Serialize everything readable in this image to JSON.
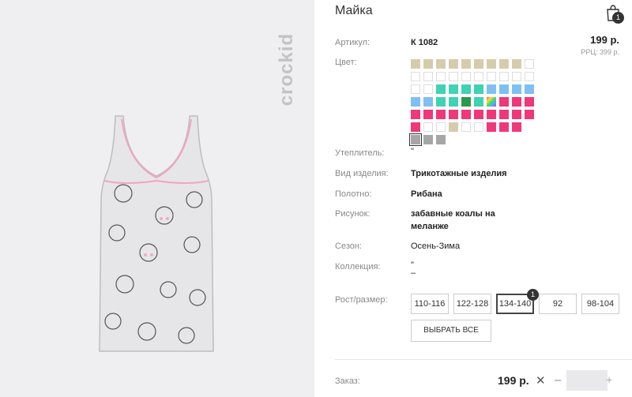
{
  "product": {
    "brand": "crockid",
    "title": "Майка",
    "cart_count": "1",
    "price": "199 р.",
    "rrp": "РРЦ: 399 р."
  },
  "details": {
    "article_label": "Артикул:",
    "article_value": "К 1082",
    "color_label": "Цвет:",
    "insulation_label": "Утеплитель:",
    "insulation_value": "\"",
    "type_label": "Вид изделия:",
    "type_value": "Трикотажные изделия",
    "fabric_label": "Полотно:",
    "fabric_value": "Рибана",
    "print_label": "Рисунок:",
    "print_value_1": "забавные коалы на",
    "print_value_2": "меланже",
    "season_label": "Сезон:",
    "season_value": "Осень-Зима",
    "collection_label": "Коллекция:",
    "collection_value_1": "\"",
    "collection_value_2": "–"
  },
  "sizes": {
    "label": "Рост/размер:",
    "options": [
      "110-116",
      "122-128",
      "134-140",
      "92",
      "98-104"
    ],
    "selected": "134-140",
    "selected_count": "1",
    "select_all": "ВЫБРАТЬ ВСЕ"
  },
  "order": {
    "label": "Заказ:",
    "price": "199 р.",
    "remove": "✕",
    "minus": "–",
    "plus": "+",
    "quantity": ""
  },
  "colors": {
    "beige": "#d6cbac",
    "white": "#ffffff",
    "turquoise": "#3fd2b5",
    "sky": "#7ec0f3",
    "green": "#2c9a4e",
    "pink": "#f0377a",
    "gray": "#a6a6a6"
  },
  "swatch_rows": [
    [
      "beige",
      "beige",
      "beige",
      "beige",
      "beige",
      "beige",
      "beige",
      "beige",
      "beige",
      "white"
    ],
    [
      "white",
      "white",
      "white",
      "white",
      "white",
      "white",
      "white",
      "white",
      "white",
      "white"
    ],
    [
      "white",
      "white",
      "turquoise",
      "turquoise",
      "turquoise",
      "turquoise",
      "sky",
      "sky",
      "sky",
      "sky"
    ],
    [
      "sky",
      "sky",
      "turquoise",
      "turquoise",
      "green",
      "turquoise",
      "rainbow",
      "pink",
      "pink",
      "pink"
    ],
    [
      "pink",
      "pink",
      "pink",
      "pink",
      "pink",
      "pink",
      "pink",
      "pink",
      "pink",
      "pink"
    ],
    [
      "pink",
      "white",
      "white",
      "beige",
      "white",
      "white",
      "pink",
      "pink",
      "pink"
    ],
    [
      "gray",
      "gray",
      "gray"
    ]
  ]
}
